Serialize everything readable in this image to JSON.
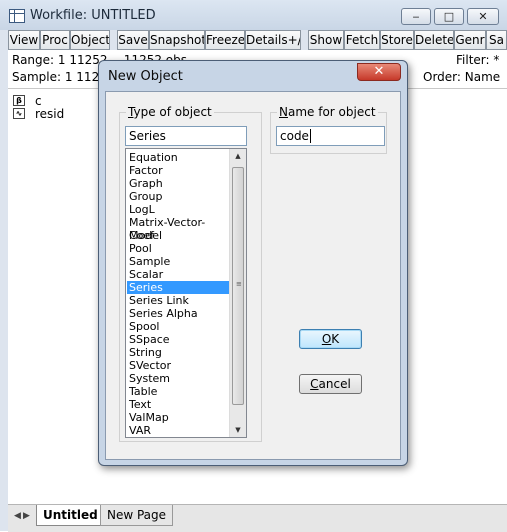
{
  "window": {
    "title": "Workfile: UNTITLED",
    "min_glyph": "‒",
    "max_glyph": "□",
    "close_glyph": "✕"
  },
  "toolbar": {
    "view": "View",
    "proc": "Proc",
    "object": "Object",
    "save": "Save",
    "snapshot": "Snapshot",
    "freeze": "Freeze",
    "details": "Details+/-",
    "show": "Show",
    "fetch": "Fetch",
    "store": "Store",
    "delete": "Delete",
    "genr": "Genr",
    "sa": "Sa"
  },
  "info": {
    "range": "Range:  1 11252  --  11252 obs",
    "sample": "Sample: 1 11252",
    "filter": "Filter: *",
    "order": "Order: Name"
  },
  "objects": [
    {
      "icon": "β",
      "name": "c"
    },
    {
      "icon": "∿",
      "name": "resid"
    }
  ],
  "tabs": {
    "prev": "◀",
    "next": "▶",
    "active": "Untitled",
    "other": "New Page"
  },
  "dialog": {
    "title": "New Object",
    "close_glyph": "✕",
    "type_group_label_u": "T",
    "type_group_label_rest": "ype of object",
    "type_value": "Series",
    "name_group_label_u": "N",
    "name_group_label_rest": "ame for object",
    "name_value": "code",
    "types": [
      "Equation",
      "Factor",
      "Graph",
      "Group",
      "LogL",
      "Matrix-Vector-Coef",
      "Model",
      "Pool",
      "Sample",
      "Scalar",
      "Series",
      "Series Link",
      "Series Alpha",
      "Spool",
      "SSpace",
      "String",
      "SVector",
      "System",
      "Table",
      "Text",
      "ValMap",
      "VAR"
    ],
    "selected_type_index": 10,
    "ok_u": "O",
    "ok_rest": "K",
    "cancel_u": "C",
    "cancel_rest": "ancel",
    "scroll_up": "▲",
    "scroll_down": "▼",
    "grip": "≡"
  }
}
